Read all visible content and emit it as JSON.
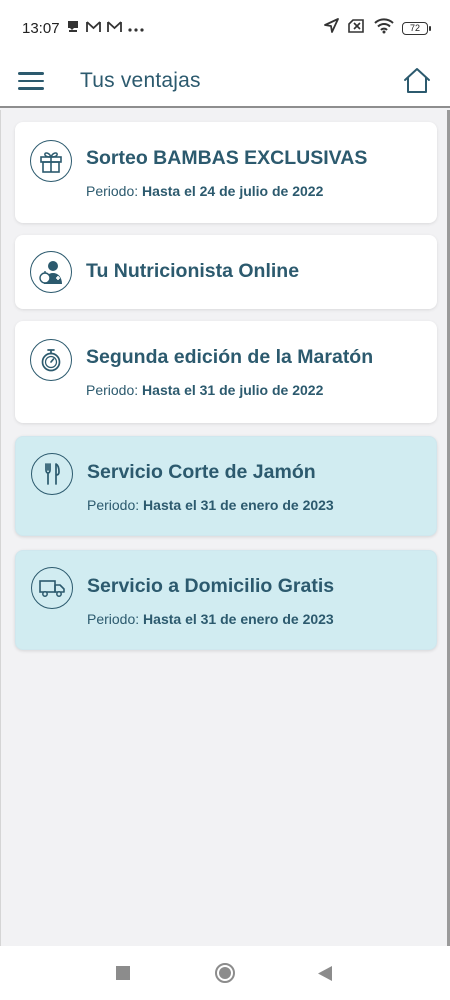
{
  "status_bar": {
    "time": "13:07",
    "icons_left": [
      "notification-icon",
      "gmail-icon",
      "gmail-icon",
      "more-dots-icon"
    ],
    "battery": "72"
  },
  "header": {
    "title": "Tus ventajas"
  },
  "cards": [
    {
      "icon": "gift-icon",
      "title": "Sorteo BAMBAS EXCLUSIVAS",
      "period_label": "Periodo:",
      "period_value": "Hasta el 24 de julio de 2022",
      "highlighted": false
    },
    {
      "icon": "nutritionist-icon",
      "title": "Tu Nutricionista Online",
      "period_label": "",
      "period_value": "",
      "highlighted": false
    },
    {
      "icon": "stopwatch-icon",
      "title": "Segunda edición de la Maratón",
      "period_label": "Periodo:",
      "period_value": "Hasta el 31 de julio de 2022",
      "highlighted": false
    },
    {
      "icon": "cutlery-icon",
      "title": "Servicio Corte de Jamón",
      "period_label": "Periodo:",
      "period_value": "Hasta el 31 de enero de 2023",
      "highlighted": true
    },
    {
      "icon": "delivery-truck-icon",
      "title": "Servicio a Domicilio Gratis",
      "period_label": "Periodo:",
      "period_value": "Hasta el 31 de enero de 2023",
      "highlighted": true
    }
  ],
  "colors": {
    "primary": "#2c5a6e",
    "highlight_card": "#d1ecf1",
    "background": "#f2f2f4"
  }
}
